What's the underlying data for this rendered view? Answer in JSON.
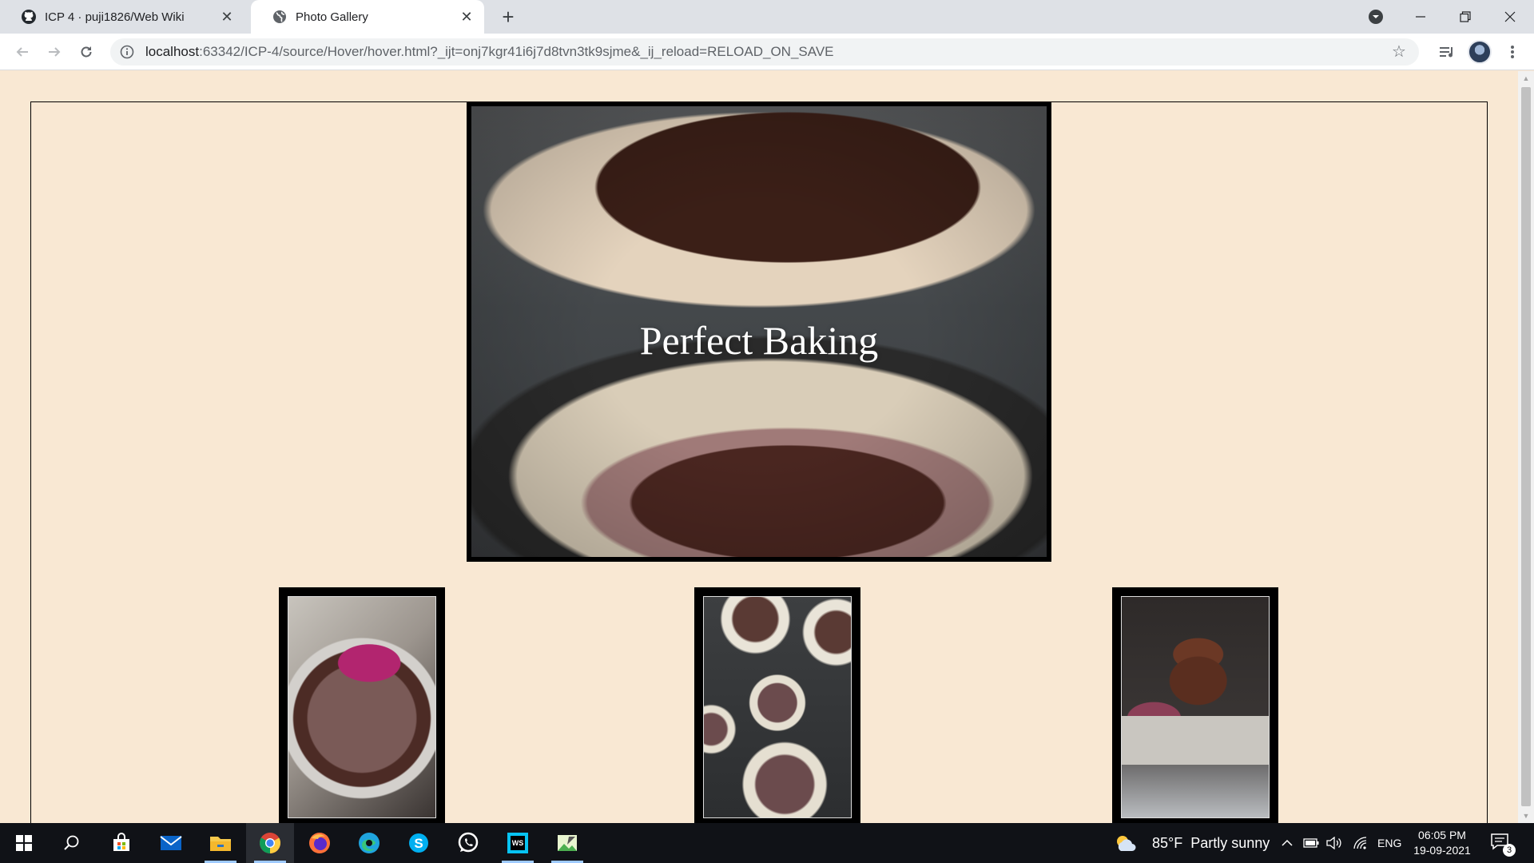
{
  "browser": {
    "tabs": [
      {
        "title": "ICP 4 · puji1826/Web Wiki",
        "favicon": "github-icon",
        "active": false
      },
      {
        "title": "Photo Gallery",
        "favicon": "globe-icon",
        "active": true
      }
    ],
    "address": {
      "host": "localhost",
      "rest": ":63342/ICP-4/source/Hover/hover.html?_ijt=onj7kgr41i6j7d8tvn3tk9sjme&_ij_reload=RELOAD_ON_SAVE"
    }
  },
  "page": {
    "hero": {
      "caption": "Perfect Baking",
      "image": "blurred-cupcake-liners-photo"
    },
    "thumbnails": [
      {
        "image": "chocolate-batter-bowl-photo"
      },
      {
        "image": "cupcake-tin-batter-photo"
      },
      {
        "image": "frosted-chocolate-cupcake-photo"
      }
    ],
    "background_color": "#f9e8d3"
  },
  "taskbar": {
    "weather": {
      "temperature": "85°F",
      "condition": "Partly sunny"
    },
    "language": "ENG",
    "time": "06:05 PM",
    "date": "19-09-2021",
    "notification_count": "3"
  }
}
